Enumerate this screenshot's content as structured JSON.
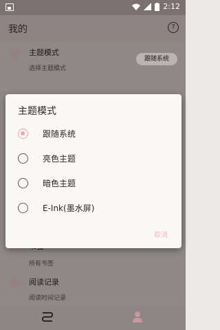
{
  "statusbar": {
    "time": "2:12"
  },
  "appbar": {
    "title": "我的"
  },
  "list": {
    "theme": {
      "title": "主题模式",
      "subtitle": "选择主题模式",
      "chip": "跟随系统"
    },
    "bookmark": {
      "title": "书签",
      "subtitle": "所有书签"
    },
    "history": {
      "title": "阅读记录",
      "subtitle": "阅读时间记录"
    }
  },
  "dialog": {
    "title": "主题模式",
    "options": [
      {
        "label": "跟随系统",
        "selected": true
      },
      {
        "label": "亮色主题",
        "selected": false
      },
      {
        "label": "暗色主题",
        "selected": false
      },
      {
        "label": "E-Ink(墨水屏)",
        "selected": false
      }
    ],
    "cancel": "取消"
  },
  "colors": {
    "accent": "#f0a6a6",
    "scrim_appbar": "#8e8484"
  }
}
